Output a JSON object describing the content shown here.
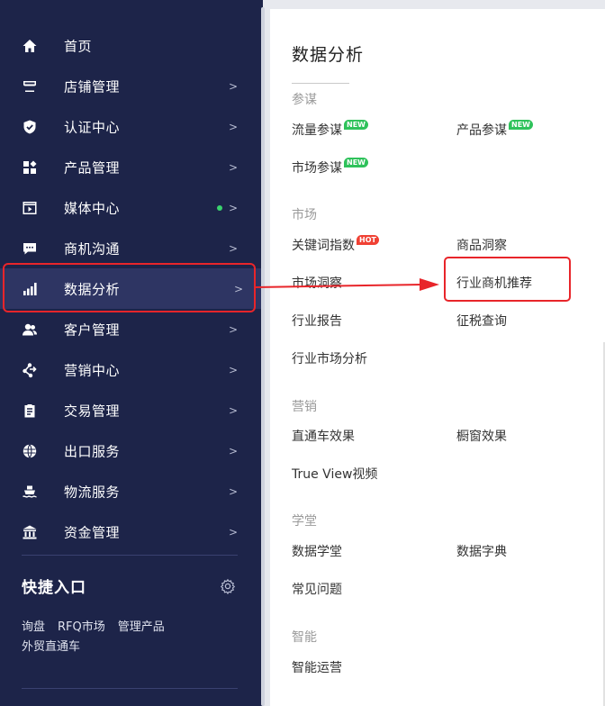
{
  "sidebar": {
    "items": [
      {
        "label": "首页",
        "icon": "home-icon",
        "chevron": ""
      },
      {
        "label": "店铺管理",
        "icon": "store-icon",
        "chevron": ">"
      },
      {
        "label": "认证中心",
        "icon": "shield-check-icon",
        "chevron": ">"
      },
      {
        "label": "产品管理",
        "icon": "product-grid-icon",
        "chevron": ">"
      },
      {
        "label": "媒体中心",
        "icon": "media-play-icon",
        "chevron": ">"
      },
      {
        "label": "商机沟通",
        "icon": "chat-icon",
        "chevron": ">"
      },
      {
        "label": "数据分析",
        "icon": "bar-chart-icon",
        "chevron": ">"
      },
      {
        "label": "客户管理",
        "icon": "customers-icon",
        "chevron": ">"
      },
      {
        "label": "营销中心",
        "icon": "marketing-icon",
        "chevron": ">"
      },
      {
        "label": "交易管理",
        "icon": "clipboard-icon",
        "chevron": ">"
      },
      {
        "label": "出口服务",
        "icon": "globe-icon",
        "chevron": ">"
      },
      {
        "label": "物流服务",
        "icon": "ship-icon",
        "chevron": ">"
      },
      {
        "label": "资金管理",
        "icon": "bank-icon",
        "chevron": ">"
      }
    ],
    "active_index": 6,
    "quick_entry": {
      "title": "快捷入口",
      "links": [
        "询盘",
        "RFQ市场",
        "管理产品",
        "外贸直通车"
      ]
    },
    "colors": {
      "background": "#1d2449",
      "active": "#2e3563",
      "dot": "#3ad36e"
    }
  },
  "panel": {
    "title": "数据分析",
    "sections": [
      {
        "title": "参谋",
        "links": [
          {
            "label": "流量参谋",
            "badge": "NEW"
          },
          {
            "label": "产品参谋",
            "badge": "NEW"
          },
          {
            "label": "市场参谋",
            "badge": "NEW"
          }
        ]
      },
      {
        "title": "市场",
        "links": [
          {
            "label": "关键词指数",
            "badge": "HOT"
          },
          {
            "label": "商品洞察",
            "badge": ""
          },
          {
            "label": "市场洞察",
            "badge": ""
          },
          {
            "label": "行业商机推荐",
            "badge": ""
          },
          {
            "label": "行业报告",
            "badge": ""
          },
          {
            "label": "征税查询",
            "badge": ""
          },
          {
            "label": "行业市场分析",
            "badge": ""
          }
        ]
      },
      {
        "title": "营销",
        "links": [
          {
            "label": "直通车效果",
            "badge": ""
          },
          {
            "label": "橱窗效果",
            "badge": ""
          },
          {
            "label": "True View视频",
            "badge": ""
          }
        ]
      },
      {
        "title": "学堂",
        "links": [
          {
            "label": "数据学堂",
            "badge": ""
          },
          {
            "label": "数据字典",
            "badge": ""
          },
          {
            "label": "常见问题",
            "badge": ""
          }
        ]
      },
      {
        "title": "智能",
        "links": [
          {
            "label": "智能运营",
            "badge": ""
          }
        ]
      }
    ],
    "highlight_color": "#e8252a"
  }
}
